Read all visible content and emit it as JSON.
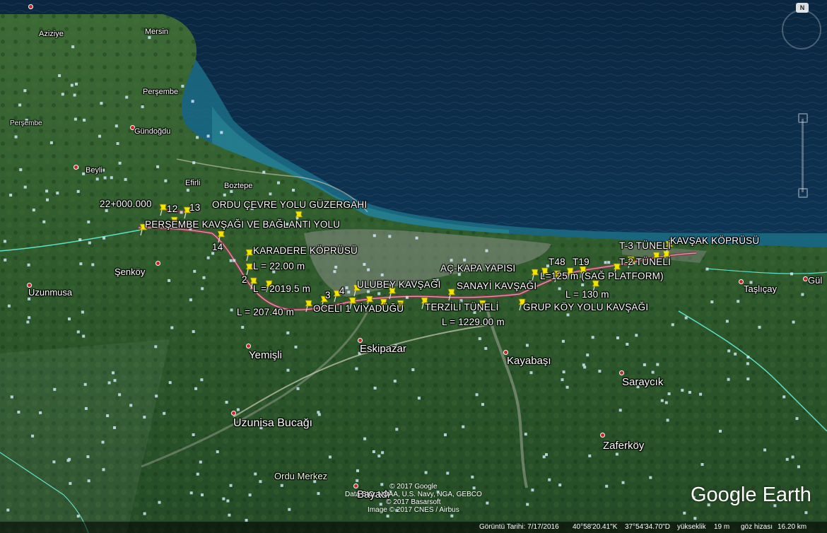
{
  "compass": "N",
  "logo": "Google Earth",
  "credits": {
    "line1": "© 2017 Google",
    "line2": "Data SIO, NOAA, U.S. Navy, NGA, GEBCO",
    "line3": "© 2017 Basarsoft",
    "line4": "Image © 2017 CNES / Airbus"
  },
  "status": {
    "imagery_date": "Görüntü Tarihi: 7/17/2016",
    "lat": "40°58'20.41\"K",
    "lon": "37°54'34.70\"D",
    "elev_label": "yükseklik",
    "elev_value": "19 m",
    "eye_label": "göz hizası",
    "eye_value": "16.20 km"
  },
  "project_labels": {
    "km": "22+000.000",
    "n12": "12",
    "n13": "13",
    "n14": "14",
    "n2": "2",
    "n3": "3",
    "n4": "4",
    "cevre": "ORDU ÇEVRE YOLU GÜZERGAHI",
    "persembe": "PERŞEMBE KAVŞAĞI VE BAĞLANTI YOLU",
    "karadere": "KARADERE KÖPRÜSÜ",
    "l22": "L = 22.00 m",
    "l2019": "L = 2019.5 m",
    "l207": "L = 207.40 m",
    "oceli": "OCELİ 1 VİYADÜĞÜ",
    "ulubey": "ULUBEY KAVŞAĞI",
    "sanayi": "SANAYİ KAVŞAĞI",
    "ackapa": "AÇ-KAPA YAPISI",
    "terzili": "TERZİLİ TÜNELİ",
    "l1229": "L = 1229.00 m",
    "grupkoy": "GRUP KÖY YOLU KAVŞAĞI",
    "t48": "T48",
    "t19": "T19",
    "l125": "L=125 m (SAĞ PLATFORM)",
    "l130": "L = 130 m",
    "t3": "T-3 TÜNELİ",
    "t2": "T-2 TÜNELİ",
    "kavsak": "KAVŞAK KÖPRÜSÜ"
  },
  "places": {
    "aziziye": "Aziziye",
    "mersin": "Mersin",
    "persembe_town": "Perşembe",
    "persembe_district": "Perşembe",
    "gundogdu": "Gündoğdu",
    "beyli": "Beyli",
    "efirli": "Efirli",
    "boztepe": "Boztepe",
    "senkoy": "Şenköy",
    "uzunmusa": "Uzunmusa",
    "yemisli": "Yemişli",
    "eskipazar": "Eskipazar",
    "kayabasi": "Kayabaşı",
    "saraycik": "Saraycık",
    "uzunisa": "Uzunisa Bucağı",
    "zaferkoy": "Zaferköy",
    "ordu_merkez": "Ordu Merkez",
    "bayadi": "Bayadı",
    "taslicay": "Taşlıçay",
    "gul": "Gül"
  },
  "colors": {
    "sea_deep": "#0b2d4c",
    "sea_coastal": "#1d6e8a",
    "land": "#2f5a2e",
    "route": "#8b3a4a",
    "pin": "#f2e600",
    "boundary": "#5fe0c8"
  }
}
